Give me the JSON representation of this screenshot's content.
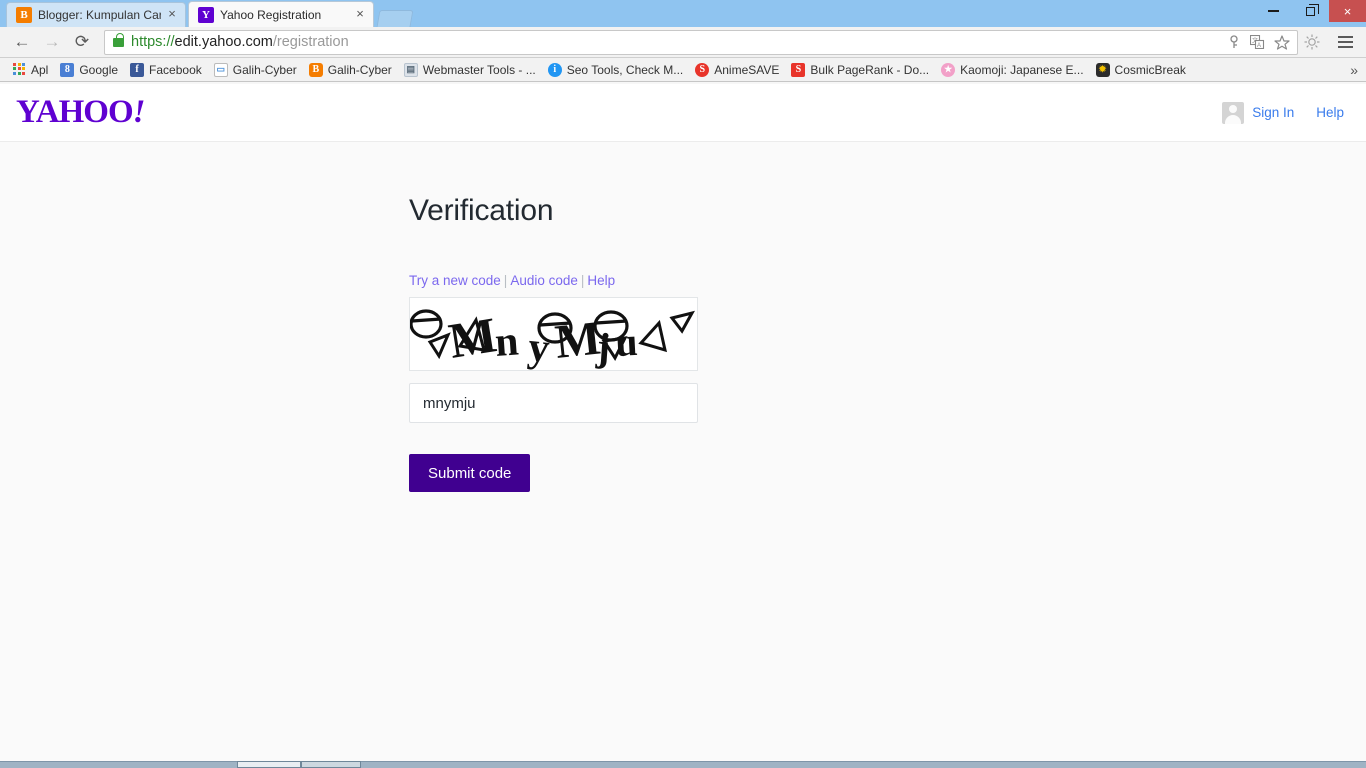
{
  "window": {
    "minimize_label": "–",
    "maximize_label": "❐",
    "close_label": "×"
  },
  "tabs": [
    {
      "title": "Blogger: Kumpulan Cara M",
      "favicon": "blogger-icon",
      "active": false,
      "close_label": "×"
    },
    {
      "title": "Yahoo Registration",
      "favicon": "yahoo-icon",
      "active": true,
      "close_label": "×"
    }
  ],
  "toolbar": {
    "back_label": "←",
    "forward_label": "→",
    "reload_label": "⟳",
    "url_scheme": "https://",
    "url_host": "edit.yahoo.com",
    "url_path": "/registration",
    "url_full": "https://edit.yahoo.com/registration",
    "icons": [
      "key-icon",
      "translate-icon",
      "star-bookmark-icon",
      "extension-gear-icon",
      "chrome-menu-icon"
    ]
  },
  "bookmarks": {
    "items": [
      {
        "label": "Apl",
        "icon": "apps-grid-icon"
      },
      {
        "label": "Google",
        "icon": "google-icon"
      },
      {
        "label": "Facebook",
        "icon": "facebook-icon"
      },
      {
        "label": "Galih-Cyber",
        "icon": "generic-page-icon"
      },
      {
        "label": "Galih-Cyber",
        "icon": "blogger-icon"
      },
      {
        "label": "Webmaster Tools - ...",
        "icon": "webmaster-tools-icon"
      },
      {
        "label": "Seo Tools, Check M...",
        "icon": "seo-info-icon"
      },
      {
        "label": "AnimeSAVE",
        "icon": "animesave-icon"
      },
      {
        "label": "Bulk PageRank - Do...",
        "icon": "bulk-pagerank-icon"
      },
      {
        "label": "Kaomoji: Japanese E...",
        "icon": "kaomoji-star-icon"
      },
      {
        "label": "CosmicBreak",
        "icon": "cosmicbreak-icon"
      }
    ],
    "overflow_label": "»"
  },
  "yahoo_header": {
    "logo_text": "YAHOO",
    "logo_bang": "!",
    "sign_in_label": "Sign In",
    "help_label": "Help"
  },
  "main": {
    "title": "Verification",
    "links": {
      "try_new_code": "Try a new code",
      "audio_code": "Audio code",
      "help": "Help",
      "separator": "|"
    },
    "captcha": {
      "alt_text": "MnyMju",
      "letters": "MnyMju"
    },
    "code_input": {
      "value": "mnymju",
      "placeholder": ""
    },
    "submit_label": "Submit code"
  },
  "colors": {
    "yahoo_purple": "#5f01d1",
    "submit_purple": "#400090",
    "link_blue": "#3a7cec",
    "captcha_link": "#7b68ee",
    "titlebar_blue": "#8fc4f0",
    "close_red": "#c75050"
  }
}
